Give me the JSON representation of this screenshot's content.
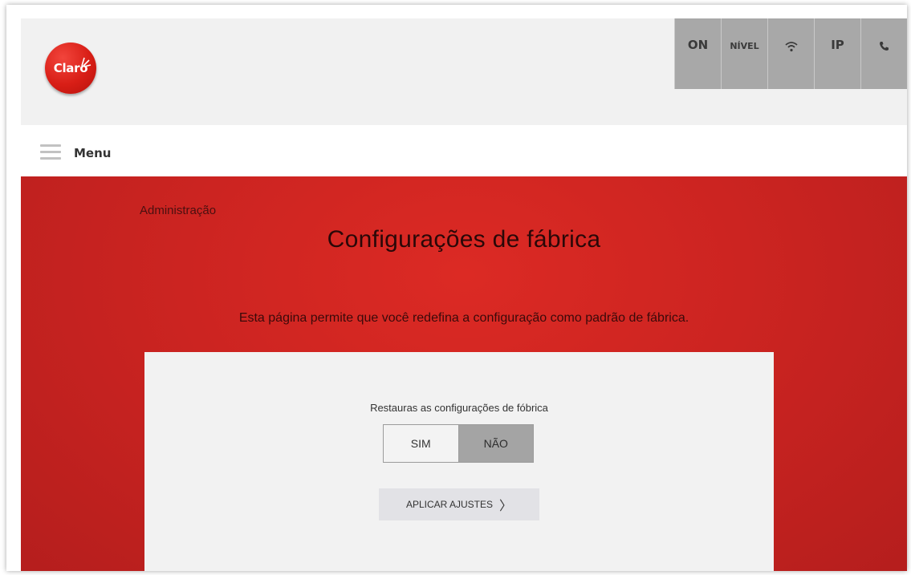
{
  "header": {
    "logo_text": "Claro",
    "status_items": [
      {
        "name": "on",
        "label": "ON"
      },
      {
        "name": "nivel",
        "label": "NÍVEL"
      },
      {
        "name": "wifi",
        "icon": "wifi-icon"
      },
      {
        "name": "ip",
        "label": "IP"
      },
      {
        "name": "phone",
        "icon": "phone-icon"
      }
    ]
  },
  "menu": {
    "label": "Menu"
  },
  "main": {
    "breadcrumb": "Administração",
    "title": "Configurações de fábrica",
    "description": "Esta página permite que você redefina a configuração como padrão de fábrica.",
    "panel": {
      "label": "Restauras as configurações de fóbrica",
      "toggle": {
        "yes": "SIM",
        "no": "NÃO",
        "selected": "NÃO"
      },
      "apply_button": "APLICAR AJUSTES"
    }
  },
  "colors": {
    "brand_red": "#cc2421",
    "status_gray": "#a8a8a8"
  }
}
